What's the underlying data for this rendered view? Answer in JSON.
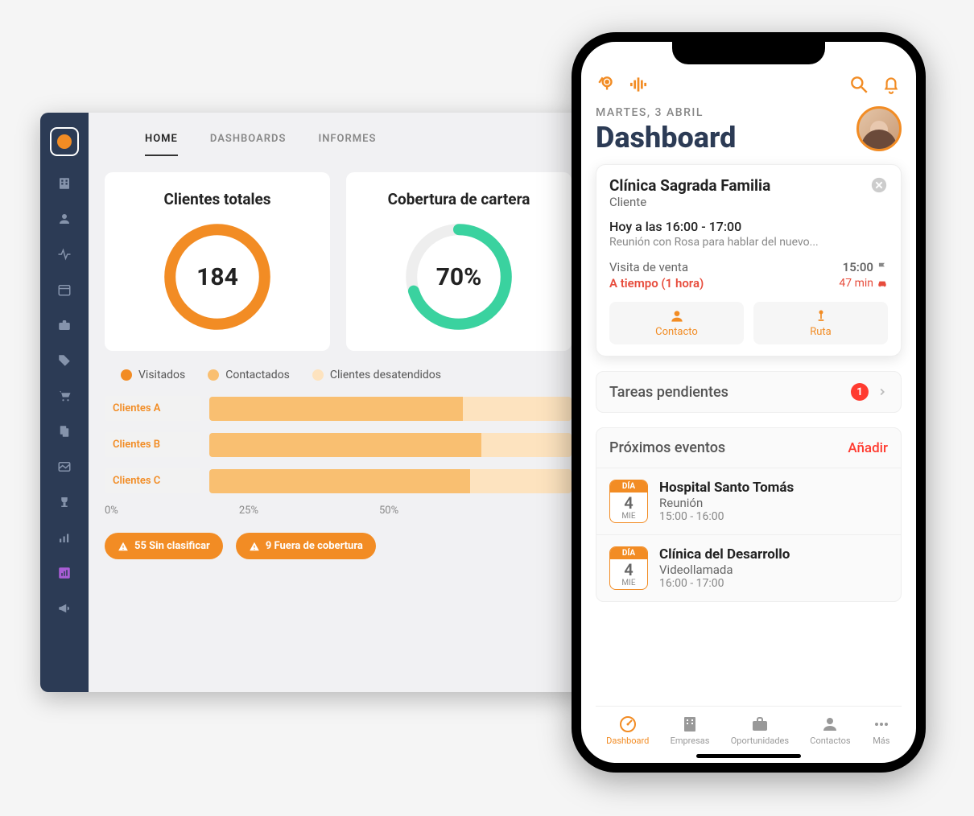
{
  "desktop": {
    "tabs": {
      "home": "HOME",
      "dashboards": "DASHBOARDS",
      "reports": "INFORMES"
    },
    "card1": {
      "title": "Clientes totales",
      "value": "184"
    },
    "card2": {
      "title": "Cobertura de cartera",
      "value": "70%"
    },
    "legend": {
      "visited": "Visitados",
      "contacted": "Contactados",
      "neglected": "Clientes desatendidos"
    },
    "bars": {
      "a": "Clientes A",
      "b": "Clientes B",
      "c": "Clientes C"
    },
    "axis": {
      "t0": "0%",
      "t25": "25%",
      "t50": "50%"
    },
    "chips": {
      "unclass": "55 Sin clasificar",
      "outcov": "9 Fuera de cobertura"
    }
  },
  "phone": {
    "date": "MARTES, 3 ABRIL",
    "title": "Dashboard",
    "visit": {
      "name": "Clínica Sagrada Familia",
      "type": "Cliente",
      "when": "Hoy a las 16:00 - 17:00",
      "desc": "Reunión con Rosa para hablar del nuevo...",
      "kind": "Visita de venta",
      "time": "15:00",
      "status": "A tiempo  (1 hora)",
      "eta": "47 min",
      "btn_contact": "Contacto",
      "btn_route": "Ruta"
    },
    "tasks": {
      "title": "Tareas pendientes",
      "count": "1"
    },
    "events": {
      "title": "Próximos eventos",
      "add": "Añadir",
      "day_label": "DÍA",
      "e1": {
        "day": "4",
        "dow": "MIE",
        "name": "Hospital Santo Tomás",
        "type": "Reunión",
        "time": "15:00 - 16:00"
      },
      "e2": {
        "day": "4",
        "dow": "MIE",
        "name": "Clínica del Desarrollo",
        "type": "Videollamada",
        "time": "16:00 - 17:00"
      }
    },
    "nav": {
      "dash": "Dashboard",
      "comp": "Empresas",
      "opp": "Oportunidades",
      "cont": "Contactos",
      "more": "Más"
    }
  },
  "chart_data": [
    {
      "type": "pie",
      "title": "Clientes totales",
      "values": [
        184
      ],
      "annotation": "orange full ring"
    },
    {
      "type": "pie",
      "title": "Cobertura de cartera",
      "values": [
        70,
        30
      ],
      "colors": [
        "#3ad29f",
        "#eeeeee"
      ],
      "annotation": "70%"
    },
    {
      "type": "bar",
      "title": "Clientes por segmento",
      "categories": [
        "Clientes A",
        "Clientes B",
        "Clientes C"
      ],
      "series": [
        {
          "name": "Visitados",
          "values": [
            0,
            0,
            0
          ]
        },
        {
          "name": "Contactados",
          "values": [
            55,
            60,
            58
          ]
        },
        {
          "name": "Clientes desatendidos",
          "values": [
            22,
            18,
            20
          ]
        }
      ],
      "xlabel": "%",
      "xlim": [
        0,
        100
      ],
      "xticks": [
        0,
        25,
        50
      ]
    }
  ]
}
